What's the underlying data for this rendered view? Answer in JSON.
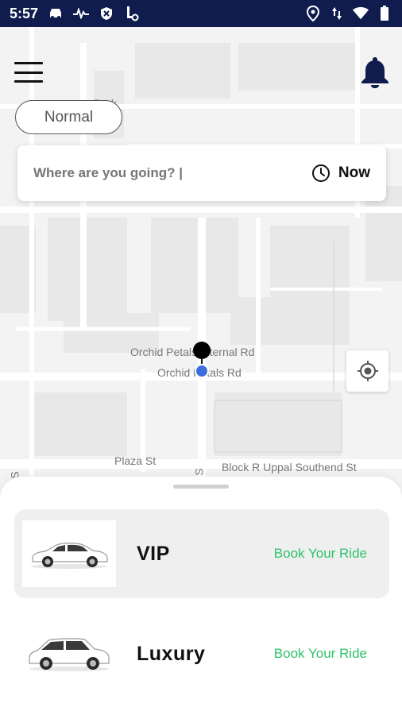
{
  "status_bar": {
    "time": "5:57",
    "left_icons": [
      "car-notification-icon",
      "signal-activity-icon",
      "shield-icon",
      "key-icon"
    ],
    "right_icons": [
      "location-icon",
      "data-arrows-icon",
      "wifi-icon",
      "battery-icon"
    ]
  },
  "map": {
    "labels": {
      "park": "Park",
      "orchid_petals_internal": "Orchid Petals Internal Rd",
      "orchid_petals": "Orchid Petals Rd",
      "plaza": "Plaza St",
      "block_r": "Block R Uppal Southend St",
      "s_left": "S",
      "s_mid": "S"
    }
  },
  "header": {
    "mode": "Normal"
  },
  "search": {
    "placeholder": "Where are you going? |",
    "schedule_label": "Now"
  },
  "rides": [
    {
      "name": "VIP",
      "action": "Book Your Ride"
    },
    {
      "name": "Luxury",
      "action": "Book Your Ride"
    }
  ],
  "colors": {
    "status_bar": "#0f1c4d",
    "bell": "#0f1c4d",
    "action_text": "#2ec26a",
    "location_dot": "#3d6fdc"
  }
}
